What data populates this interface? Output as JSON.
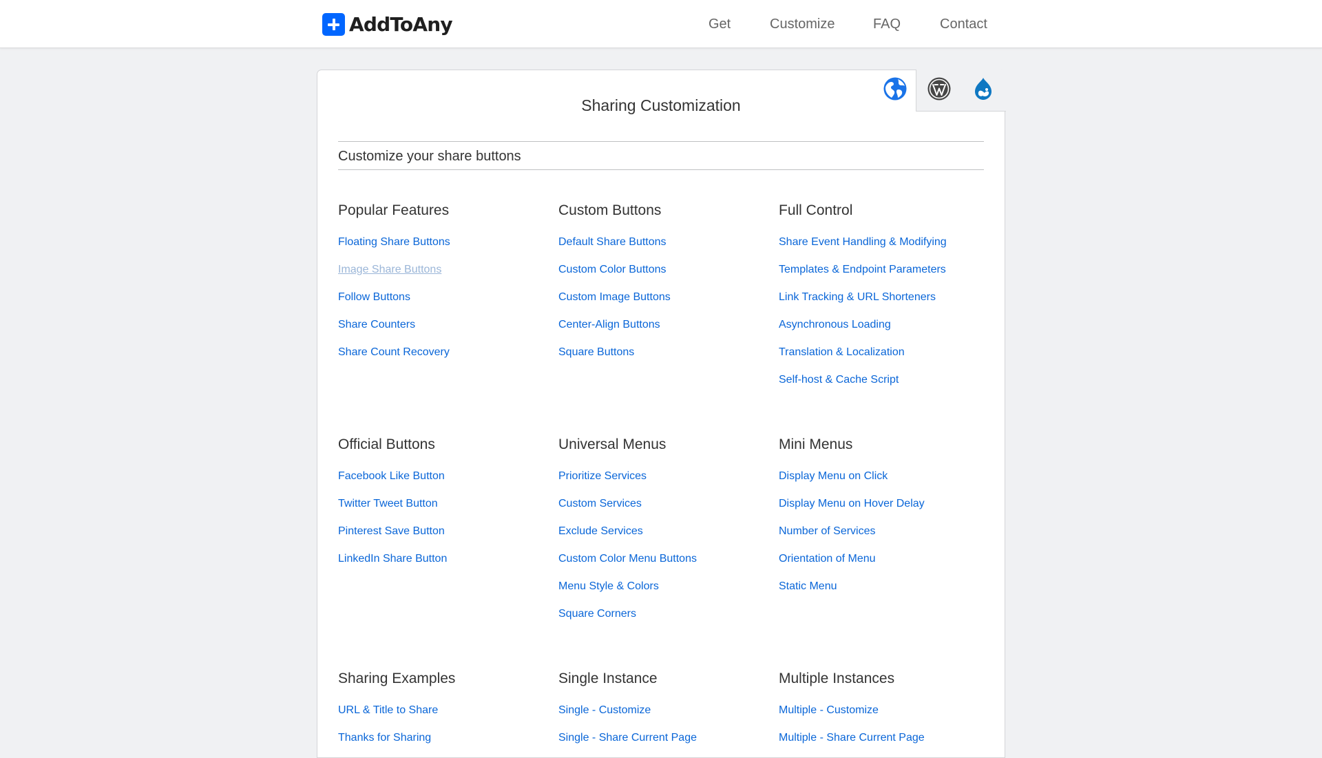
{
  "brand": {
    "name": "AddToAny"
  },
  "nav": {
    "items": [
      "Get",
      "Customize",
      "FAQ",
      "Contact"
    ]
  },
  "platform_tabs": [
    "globe-icon",
    "wordpress-icon",
    "drupal-icon"
  ],
  "colors": {
    "link": "#0a66d8",
    "accent": "#0166ff",
    "visited_link": "#9bb6d8"
  },
  "page": {
    "title": "Sharing Customization",
    "subtitle": "Customize your share buttons"
  },
  "sections": [
    {
      "title": "Popular Features",
      "links": [
        "Floating Share Buttons",
        "Image Share Buttons",
        "Follow Buttons",
        "Share Counters",
        "Share Count Recovery"
      ]
    },
    {
      "title": "Custom Buttons",
      "links": [
        "Default Share Buttons",
        "Custom Color Buttons",
        "Custom Image Buttons",
        "Center-Align Buttons",
        "Square Buttons"
      ]
    },
    {
      "title": "Full Control",
      "links": [
        "Share Event Handling & Modifying",
        "Templates & Endpoint Parameters",
        "Link Tracking & URL Shorteners",
        "Asynchronous Loading",
        "Translation & Localization",
        "Self-host & Cache Script"
      ]
    },
    {
      "title": "Official Buttons",
      "links": [
        "Facebook Like Button",
        "Twitter Tweet Button",
        "Pinterest Save Button",
        "LinkedIn Share Button"
      ]
    },
    {
      "title": "Universal Menus",
      "links": [
        "Prioritize Services",
        "Custom Services",
        "Exclude Services",
        "Custom Color Menu Buttons",
        "Menu Style & Colors",
        "Square Corners"
      ]
    },
    {
      "title": "Mini Menus",
      "links": [
        "Display Menu on Click",
        "Display Menu on Hover Delay",
        "Number of Services",
        "Orientation of Menu",
        "Static Menu"
      ]
    },
    {
      "title": "Sharing Examples",
      "links": [
        "URL & Title to Share",
        "Thanks for Sharing"
      ]
    },
    {
      "title": "Single Instance",
      "links": [
        "Single - Customize",
        "Single - Share Current Page"
      ]
    },
    {
      "title": "Multiple Instances",
      "links": [
        "Multiple - Customize",
        "Multiple - Share Current Page"
      ]
    }
  ],
  "visited_link": "Image Share Buttons"
}
